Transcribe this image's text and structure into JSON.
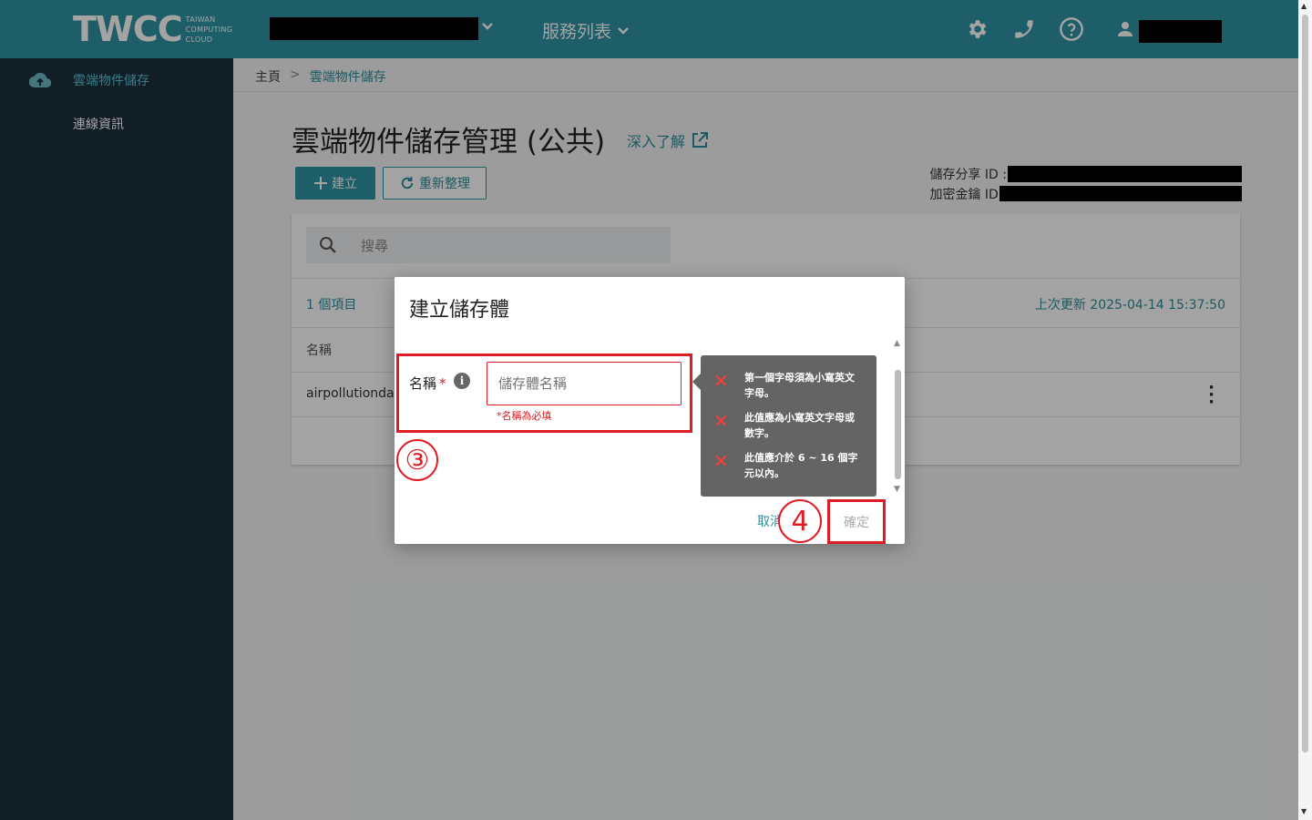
{
  "header": {
    "logo_text": "TWCC",
    "logo_sub": [
      "TAIWAN",
      "COMPUTING",
      "CLOUD"
    ],
    "services_menu": "服務列表"
  },
  "sidebar": {
    "items": [
      {
        "label": "雲端物件儲存",
        "icon": "cloud-upload-icon",
        "active": true
      },
      {
        "label": "連線資訊",
        "icon": "",
        "active": false
      }
    ]
  },
  "breadcrumb": {
    "home": "主頁",
    "separator": ">",
    "current": "雲端物件儲存"
  },
  "page": {
    "title": "雲端物件儲存管理 (公共)",
    "learn_more": "深入了解",
    "create_label": "建立",
    "refresh_label": "重新整理",
    "share_id_label": "儲存分享 ID :",
    "secret_key_label": "加密金鑰 ID :"
  },
  "table": {
    "search_placeholder": "搜尋",
    "count": "1 個項目",
    "last_updated": "上次更新 2025-04-14 15:37:50",
    "columns": [
      "名稱"
    ],
    "rows": [
      {
        "name": "airpollutiondat"
      }
    ]
  },
  "dialog": {
    "title": "建立儲存體",
    "field_label": "名稱",
    "required_mark": "*",
    "input_placeholder": "儲存體名稱",
    "input_value": "",
    "error": "*名稱為必填",
    "rules": [
      "第一個字母須為小寫英文字母。",
      "此值應為小寫英文字母或數字。",
      "此值應介於 6 ~ 16 個字元以內。"
    ],
    "cancel_label": "取消",
    "confirm_label": "確定",
    "step_marker_3": "③",
    "step_marker_4": "4"
  },
  "colors": {
    "primary": "#2f94a3",
    "sidebar": "#1c2f3c",
    "error": "#e01b24"
  }
}
